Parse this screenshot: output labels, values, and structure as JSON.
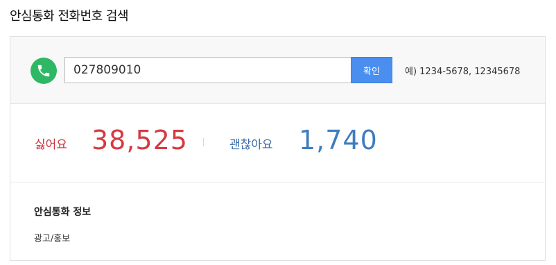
{
  "page": {
    "title": "안심통화 전화번호 검색"
  },
  "search": {
    "value": "027809010",
    "button_label": "확인",
    "example": "예) 1234-5678, 12345678",
    "icon": "phone-icon",
    "icon_color": "#2eb865"
  },
  "stats": {
    "dislike_label": "싫어요",
    "dislike_count": "38,525",
    "dislike_color": "#d53a42",
    "like_label": "괜찮아요",
    "like_count": "1,740",
    "like_color": "#3f7cbe"
  },
  "info": {
    "title": "안심통화 정보",
    "category": "광고/홍보"
  }
}
